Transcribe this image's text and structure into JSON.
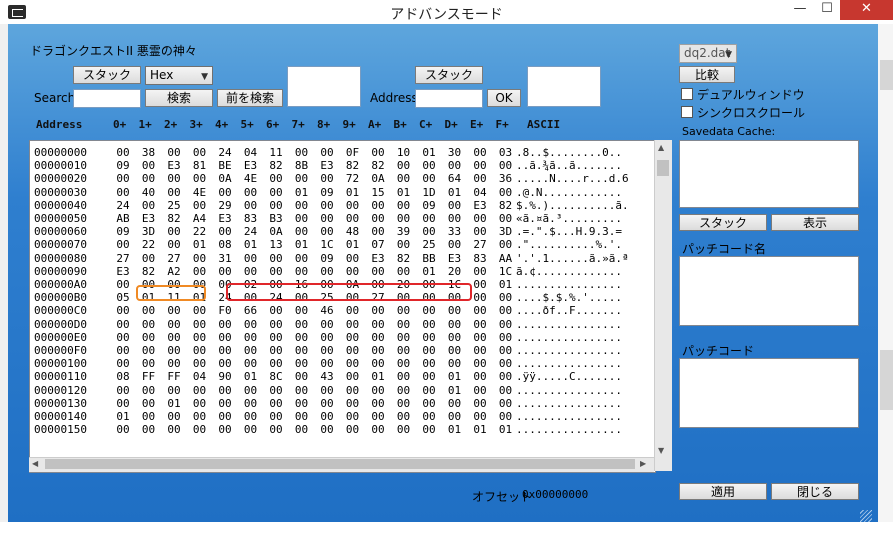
{
  "window": {
    "title": "アドバンスモード",
    "min": "—",
    "max": "☐",
    "close": "✕"
  },
  "game_title": "ドラゴンクエストII 悪霊の神々",
  "left": {
    "stack_label": "スタック",
    "mode_value": "Hex",
    "search_label": "Search",
    "search_button": "検索",
    "prev_search_button": "前を検索",
    "stack2_label": "スタック",
    "address_label": "Address",
    "ok_button": "OK"
  },
  "grid": {
    "header_address": "Address",
    "header_cols": [
      "0+",
      "1+",
      "2+",
      "3+",
      "4+",
      "5+",
      "6+",
      "7+",
      "8+",
      "9+",
      "A+",
      "B+",
      "C+",
      "D+",
      "E+",
      "F+"
    ],
    "header_ascii": "ASCII",
    "rows": [
      {
        "addr": "00000000",
        "bytes": [
          "00",
          "38",
          "00",
          "00",
          "24",
          "04",
          "11",
          "00",
          "00",
          "0F",
          "00",
          "10",
          "01",
          "30",
          "00",
          "03"
        ],
        "ascii": ".8..$........0.."
      },
      {
        "addr": "00000010",
        "bytes": [
          "09",
          "00",
          "E3",
          "81",
          "BE",
          "E3",
          "82",
          "8B",
          "E3",
          "82",
          "82",
          "00",
          "00",
          "00",
          "00",
          "00"
        ],
        "ascii": "..ã.¾ã..ã......."
      },
      {
        "addr": "00000020",
        "bytes": [
          "00",
          "00",
          "00",
          "00",
          "0A",
          "4E",
          "00",
          "00",
          "00",
          "72",
          "0A",
          "00",
          "00",
          "64",
          "00",
          "36"
        ],
        "ascii": ".....N....r...d.6"
      },
      {
        "addr": "00000030",
        "bytes": [
          "00",
          "40",
          "00",
          "4E",
          "00",
          "00",
          "00",
          "01",
          "09",
          "01",
          "15",
          "01",
          "1D",
          "01",
          "04",
          "00"
        ],
        "ascii": ".@.N............"
      },
      {
        "addr": "00000040",
        "bytes": [
          "24",
          "00",
          "25",
          "00",
          "29",
          "00",
          "00",
          "00",
          "00",
          "00",
          "00",
          "00",
          "09",
          "00",
          "E3",
          "82"
        ],
        "ascii": "$.%.)..........ã."
      },
      {
        "addr": "00000050",
        "bytes": [
          "AB",
          "E3",
          "82",
          "A4",
          "E3",
          "83",
          "B3",
          "00",
          "00",
          "00",
          "00",
          "00",
          "00",
          "00",
          "00",
          "00"
        ],
        "ascii": "«ã.¤ã.³........."
      },
      {
        "addr": "00000060",
        "bytes": [
          "09",
          "3D",
          "00",
          "22",
          "00",
          "24",
          "0A",
          "00",
          "00",
          "48",
          "00",
          "39",
          "00",
          "33",
          "00",
          "3D"
        ],
        "ascii": ".=.\".$...H.9.3.="
      },
      {
        "addr": "00000070",
        "bytes": [
          "00",
          "22",
          "00",
          "01",
          "08",
          "01",
          "13",
          "01",
          "1C",
          "01",
          "07",
          "00",
          "25",
          "00",
          "27",
          "00"
        ],
        "ascii": ".\"..........%.'."
      },
      {
        "addr": "00000080",
        "bytes": [
          "27",
          "00",
          "27",
          "00",
          "31",
          "00",
          "00",
          "00",
          "09",
          "00",
          "E3",
          "82",
          "BB",
          "E3",
          "83",
          "AA"
        ],
        "ascii": "'.'.1......ã.»ã.ª"
      },
      {
        "addr": "00000090",
        "bytes": [
          "E3",
          "82",
          "A2",
          "00",
          "00",
          "00",
          "00",
          "00",
          "00",
          "00",
          "00",
          "00",
          "01",
          "20",
          "00",
          "1C"
        ],
        "ascii": "ã.¢............."
      },
      {
        "addr": "000000A0",
        "bytes": [
          "00",
          "00",
          "00",
          "00",
          "00",
          "02",
          "00",
          "16",
          "00",
          "0A",
          "00",
          "20",
          "00",
          "1C",
          "00",
          "01"
        ],
        "ascii": "................"
      },
      {
        "addr": "000000B0",
        "bytes": [
          "05",
          "01",
          "11",
          "01",
          "24",
          "00",
          "24",
          "00",
          "25",
          "00",
          "27",
          "00",
          "00",
          "00",
          "00",
          "00"
        ],
        "ascii": "....$.$.%.'....."
      },
      {
        "addr": "000000C0",
        "bytes": [
          "00",
          "00",
          "00",
          "00",
          "F0",
          "66",
          "00",
          "00",
          "46",
          "00",
          "00",
          "00",
          "00",
          "00",
          "00",
          "00"
        ],
        "ascii": "....ðf..F......."
      },
      {
        "addr": "000000D0",
        "bytes": [
          "00",
          "00",
          "00",
          "00",
          "00",
          "00",
          "00",
          "00",
          "00",
          "00",
          "00",
          "00",
          "00",
          "00",
          "00",
          "00"
        ],
        "ascii": "................"
      },
      {
        "addr": "000000E0",
        "bytes": [
          "00",
          "00",
          "00",
          "00",
          "00",
          "00",
          "00",
          "00",
          "00",
          "00",
          "00",
          "00",
          "00",
          "00",
          "00",
          "00"
        ],
        "ascii": "................"
      },
      {
        "addr": "000000F0",
        "bytes": [
          "00",
          "00",
          "00",
          "00",
          "00",
          "00",
          "00",
          "00",
          "00",
          "00",
          "00",
          "00",
          "00",
          "00",
          "00",
          "00"
        ],
        "ascii": "................"
      },
      {
        "addr": "00000100",
        "bytes": [
          "00",
          "00",
          "00",
          "00",
          "00",
          "00",
          "00",
          "00",
          "00",
          "00",
          "00",
          "00",
          "00",
          "00",
          "00",
          "00"
        ],
        "ascii": "................"
      },
      {
        "addr": "00000110",
        "bytes": [
          "08",
          "FF",
          "FF",
          "04",
          "90",
          "01",
          "8C",
          "00",
          "43",
          "00",
          "01",
          "00",
          "00",
          "01",
          "00",
          "00"
        ],
        "ascii": ".ÿÿ.....C......."
      },
      {
        "addr": "00000120",
        "bytes": [
          "00",
          "00",
          "00",
          "00",
          "00",
          "00",
          "00",
          "00",
          "00",
          "00",
          "00",
          "00",
          "00",
          "01",
          "00",
          "00"
        ],
        "ascii": "................"
      },
      {
        "addr": "00000130",
        "bytes": [
          "00",
          "00",
          "01",
          "00",
          "00",
          "00",
          "00",
          "00",
          "00",
          "00",
          "00",
          "00",
          "00",
          "00",
          "00",
          "00"
        ],
        "ascii": "................"
      },
      {
        "addr": "00000140",
        "bytes": [
          "01",
          "00",
          "00",
          "00",
          "00",
          "00",
          "00",
          "00",
          "00",
          "00",
          "00",
          "00",
          "00",
          "00",
          "00",
          "00"
        ],
        "ascii": "................"
      },
      {
        "addr": "00000150",
        "bytes": [
          "00",
          "00",
          "00",
          "00",
          "00",
          "00",
          "00",
          "00",
          "00",
          "00",
          "00",
          "00",
          "00",
          "01",
          "01",
          "01"
        ],
        "ascii": "................"
      }
    ]
  },
  "right": {
    "file_select": "dq2.dat",
    "compare_button": "比較",
    "dual_window": "デュアルウィンドウ",
    "sync_scroll": "シンクロスクロール",
    "savedata_cache": "Savedata Cache:",
    "stack_button": "スタック",
    "display_button": "表示",
    "patch_name_label": "パッチコード名",
    "patch_code_label": "パッチコード",
    "apply_button": "適用",
    "close_button": "閉じる"
  },
  "offset_label": "オフセット",
  "offset_value": "0x00000000",
  "colors": {
    "frame": "#2f7fcf",
    "orange_highlight": "#f08a24",
    "red_highlight": "#e0262a",
    "close": "#c7372f"
  }
}
